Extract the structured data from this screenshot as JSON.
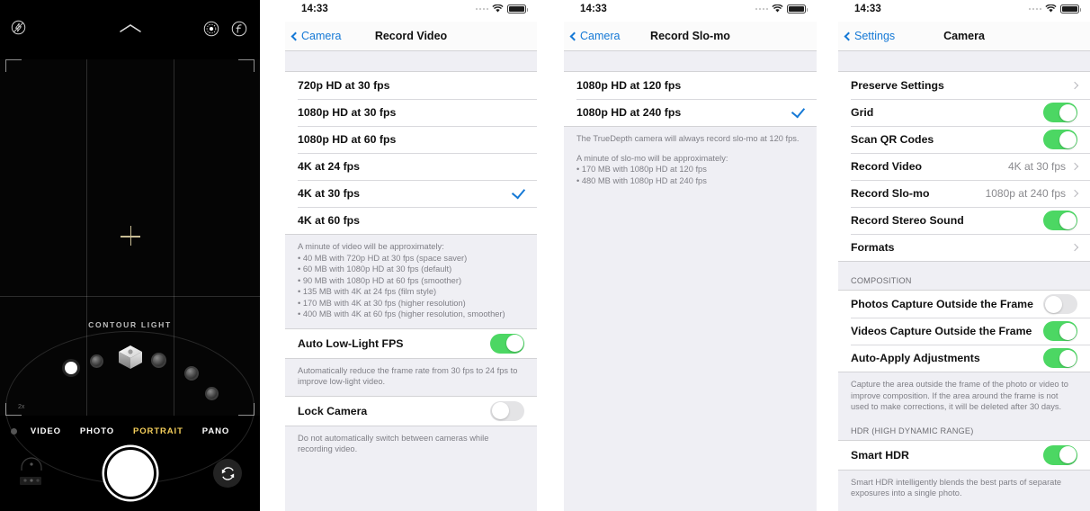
{
  "camera_app": {
    "name": "iOS Camera",
    "icons": {
      "flash": "flash-off-icon",
      "chevron": "chevron-up-icon",
      "live_photo": "live-photo-icon",
      "filters": "f-stop-icon",
      "focus": "focus-crosshair-icon",
      "flip": "flip-camera-icon"
    },
    "portrait_lighting_label": "CONTOUR LIGHT",
    "zoom_tag": "2x",
    "modes": [
      {
        "label": "VIDEO",
        "active": false
      },
      {
        "label": "PHOTO",
        "active": false
      },
      {
        "label": "PORTRAIT",
        "active": true
      },
      {
        "label": "PANO",
        "active": false
      }
    ]
  },
  "panel_record_video": {
    "statusbar": {
      "time": "14:33"
    },
    "nav": {
      "back": "Camera",
      "title": "Record Video"
    },
    "options": [
      {
        "label": "720p HD at 30 fps",
        "selected": false
      },
      {
        "label": "1080p HD at 30 fps",
        "selected": false
      },
      {
        "label": "1080p HD at 60 fps",
        "selected": false
      },
      {
        "label": "4K at 24 fps",
        "selected": false
      },
      {
        "label": "4K at 30 fps",
        "selected": true
      },
      {
        "label": "4K at 60 fps",
        "selected": false
      }
    ],
    "footnote_intro": "A minute of video will be approximately:",
    "footnote_bullets": [
      "• 40 MB with 720p HD at 30 fps (space saver)",
      "• 60 MB with 1080p HD at 30 fps (default)",
      "• 90 MB with 1080p HD at 60 fps (smoother)",
      "• 135 MB with 4K at 24 fps (film style)",
      "• 170 MB with 4K at 30 fps (higher resolution)",
      "• 400 MB with 4K at 60 fps (higher resolution, smoother)"
    ],
    "auto_low_light": {
      "label": "Auto Low-Light FPS",
      "on": true
    },
    "auto_low_light_footnote": "Automatically reduce the frame rate from 30 fps to 24 fps to improve low-light video.",
    "lock_camera": {
      "label": "Lock Camera",
      "on": false
    },
    "lock_camera_footnote": "Do not automatically switch between cameras while recording video."
  },
  "panel_record_slomo": {
    "statusbar": {
      "time": "14:33"
    },
    "nav": {
      "back": "Camera",
      "title": "Record Slo-mo"
    },
    "options": [
      {
        "label": "1080p HD at 120 fps",
        "selected": false
      },
      {
        "label": "1080p HD at 240 fps",
        "selected": true
      }
    ],
    "footnote_truedepth": "The TrueDepth camera will always record slo-mo at 120 fps.",
    "footnote_intro": "A minute of slo-mo will be approximately:",
    "footnote_bullets": [
      "• 170 MB with 1080p HD at 120 fps",
      "• 480 MB with 1080p HD at 240 fps"
    ]
  },
  "panel_camera_settings": {
    "statusbar": {
      "time": "14:33"
    },
    "nav": {
      "back": "Settings",
      "title": "Camera"
    },
    "group1": [
      {
        "label": "Preserve Settings",
        "type": "disclosure"
      },
      {
        "label": "Grid",
        "type": "toggle",
        "on": true
      },
      {
        "label": "Scan QR Codes",
        "type": "toggle",
        "on": true
      },
      {
        "label": "Record Video",
        "type": "value",
        "value": "4K at 30 fps"
      },
      {
        "label": "Record Slo-mo",
        "type": "value",
        "value": "1080p at 240 fps"
      },
      {
        "label": "Record Stereo Sound",
        "type": "toggle",
        "on": true
      },
      {
        "label": "Formats",
        "type": "disclosure"
      }
    ],
    "composition_header": "COMPOSITION",
    "group2": [
      {
        "label": "Photos Capture Outside the Frame",
        "type": "toggle",
        "on": false
      },
      {
        "label": "Videos Capture Outside the Frame",
        "type": "toggle",
        "on": true
      },
      {
        "label": "Auto-Apply Adjustments",
        "type": "toggle",
        "on": true
      }
    ],
    "composition_footnote": "Capture the area outside the frame of the photo or video to improve composition. If the area around the frame is not used to make corrections, it will be deleted after 30 days.",
    "hdr_header": "HDR (HIGH DYNAMIC RANGE)",
    "group3": [
      {
        "label": "Smart HDR",
        "type": "toggle",
        "on": true
      }
    ],
    "hdr_footnote": "Smart HDR intelligently blends the best parts of separate exposures into a single photo."
  },
  "colors": {
    "ios_blue": "#1579d6",
    "toggle_green": "#4cd763",
    "portrait_yellow": "#f5cf5b",
    "group_bg": "#efeff4"
  }
}
